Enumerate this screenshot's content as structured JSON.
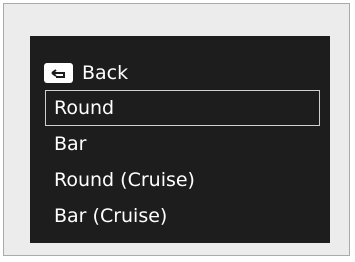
{
  "menu": {
    "back": {
      "icon": "back-return-icon",
      "label": "Back"
    },
    "items": [
      {
        "label": "Round",
        "selected": true
      },
      {
        "label": "Bar",
        "selected": false
      },
      {
        "label": "Round (Cruise)",
        "selected": false
      },
      {
        "label": "Bar (Cruise)",
        "selected": false
      }
    ]
  },
  "colors": {
    "screen_background": "#1d1d1d",
    "text": "#ffffff",
    "selection_outline": "#cfcfcf",
    "frame_background": "#ececec"
  }
}
